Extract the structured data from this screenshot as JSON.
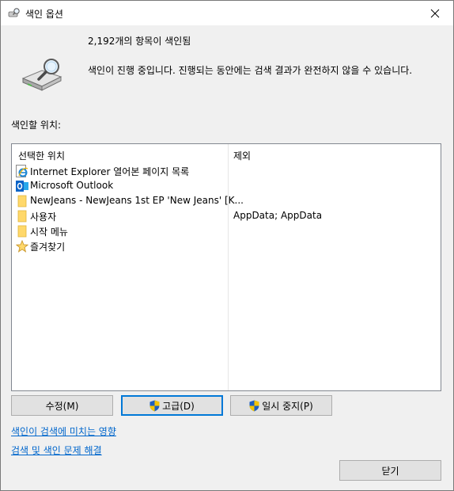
{
  "window": {
    "title": "색인 옵션",
    "icon": "indexing-options-icon"
  },
  "status": {
    "count_text": "2,192개의 항목이 색인됨",
    "message": "색인이 진행 중입니다. 진행되는 동안에는 검색 결과가 완전하지 않을 수 있습니다."
  },
  "locations_label": "색인할 위치:",
  "table": {
    "columns": [
      "선택한 위치",
      "제외"
    ],
    "rows": [
      {
        "icon": "internet-explorer-icon",
        "name": "Internet Explorer 열어본 페이지 목록",
        "exclude": ""
      },
      {
        "icon": "outlook-icon",
        "name": "Microsoft Outlook",
        "exclude": ""
      },
      {
        "icon": "folder-icon",
        "name": "NewJeans - NewJeans 1st EP 'New Jeans' [K...",
        "exclude": ""
      },
      {
        "icon": "folder-icon",
        "name": "사용자",
        "exclude": "AppData; AppData"
      },
      {
        "icon": "folder-icon",
        "name": "시작 메뉴",
        "exclude": ""
      },
      {
        "icon": "star-icon",
        "name": "즐겨찾기",
        "exclude": ""
      }
    ]
  },
  "buttons": {
    "modify": "수정(M)",
    "advanced": "고급(D)",
    "pause": "일시 중지(P)",
    "close": "닫기"
  },
  "links": {
    "effect": "색인이 검색에 미치는 영향",
    "troubleshoot": "검색 및 색인 문제 해결"
  },
  "colors": {
    "link": "#0066cc",
    "default_button_border": "#0078d7",
    "folder": "#ffd86a",
    "shield_blue": "#1f5fbf",
    "shield_yellow": "#f5c400"
  }
}
